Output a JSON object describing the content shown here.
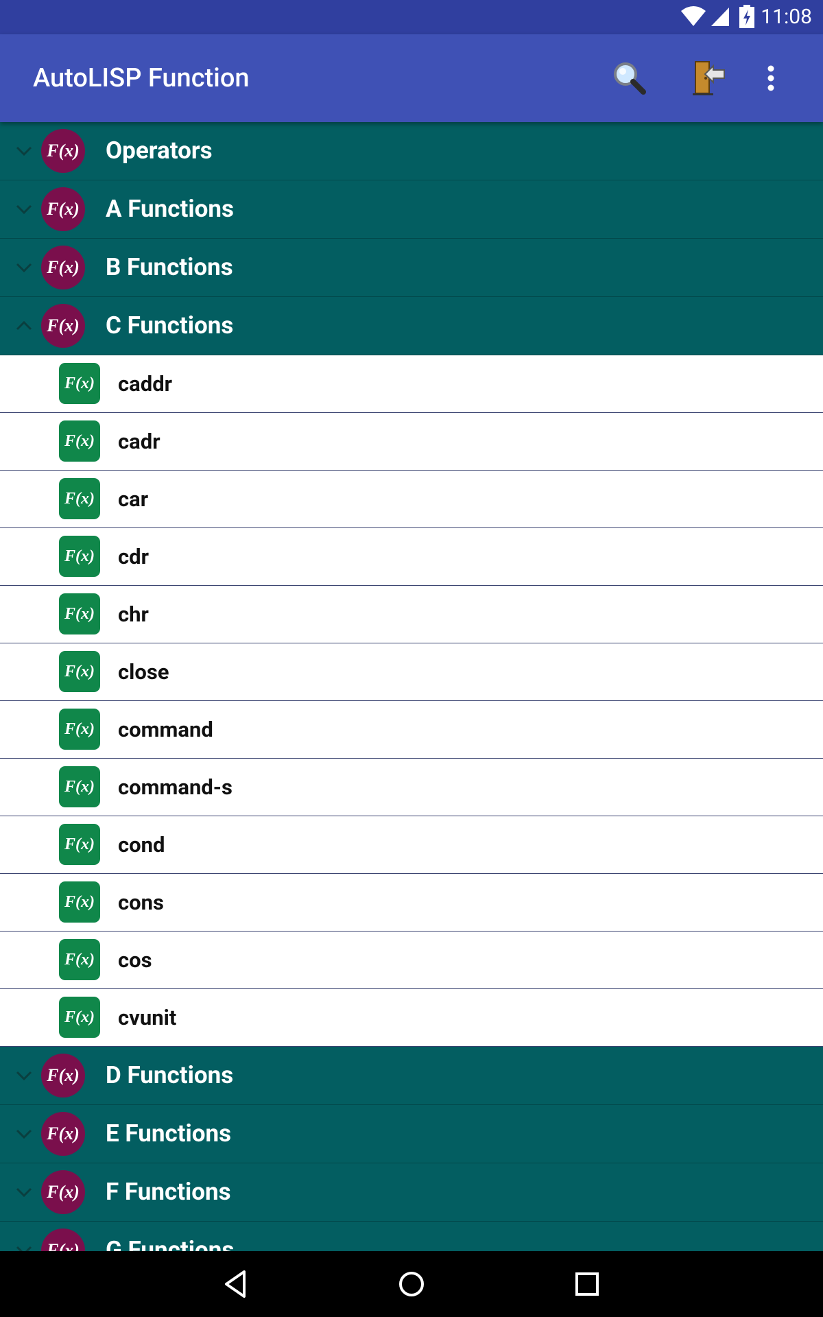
{
  "status": {
    "time": "11:08"
  },
  "appbar": {
    "title": "AutoLISP Function"
  },
  "icons": {
    "search": "search-icon",
    "exit": "exit-door-icon",
    "overflow": "more-vert-icon",
    "function": "function-icon"
  },
  "colors": {
    "status_bar": "#303f9f",
    "app_bar": "#3f51b5",
    "group_bg": "#035e61",
    "group_badge": "#7a0f4c",
    "item_icon": "#10874a"
  },
  "badge_text": "F(x)",
  "groups_before": [
    {
      "label": "Operators",
      "expanded": false
    },
    {
      "label": "A Functions",
      "expanded": false
    },
    {
      "label": "B Functions",
      "expanded": false
    },
    {
      "label": "C Functions",
      "expanded": true
    }
  ],
  "c_items": [
    "caddr",
    "cadr",
    "car",
    "cdr",
    "chr",
    "close",
    "command",
    "command-s",
    "cond",
    "cons",
    "cos",
    "cvunit"
  ],
  "groups_after": [
    {
      "label": "D Functions",
      "expanded": false
    },
    {
      "label": "E Functions",
      "expanded": false
    },
    {
      "label": "F Functions",
      "expanded": false
    },
    {
      "label": "G Functions",
      "expanded": false
    }
  ]
}
